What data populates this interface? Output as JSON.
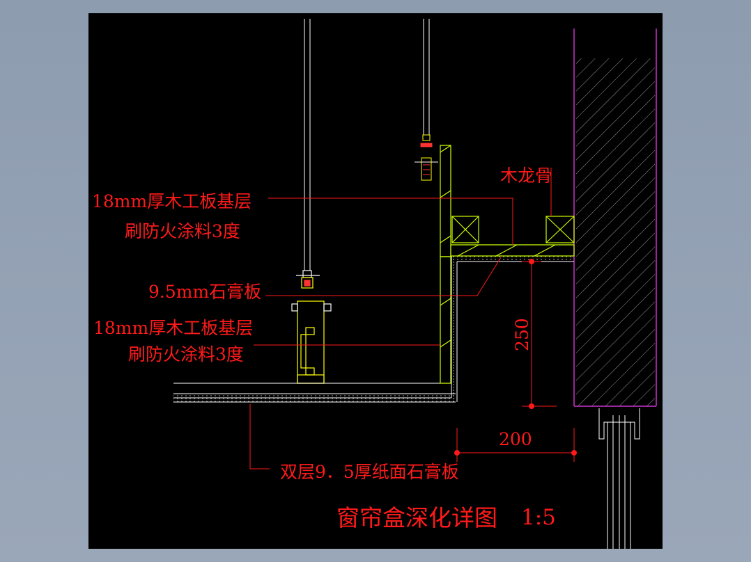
{
  "labels": {
    "wood_keel": "木龙骨",
    "plywood_top_line1": "18mm厚木工板基层",
    "plywood_top_line2": "刷防火涂料3度",
    "gypsum_board": "9.5mm石膏板",
    "plywood_mid_line1": "18mm厚木工板基层",
    "plywood_mid_line2": "刷防火涂料3度",
    "double_gypsum": "双层9．5厚纸面石膏板"
  },
  "dimensions": {
    "height": "250",
    "width": "200"
  },
  "title": "窗帘盒深化详图",
  "scale": "1:5",
  "colors": {
    "annotation": "#ff1a1a",
    "plywood": "#ccff00",
    "hanger": "#ffff00",
    "wall_outline": "#cc33cc",
    "lines": "#ffffff",
    "hatch": "#9a9a9a"
  }
}
